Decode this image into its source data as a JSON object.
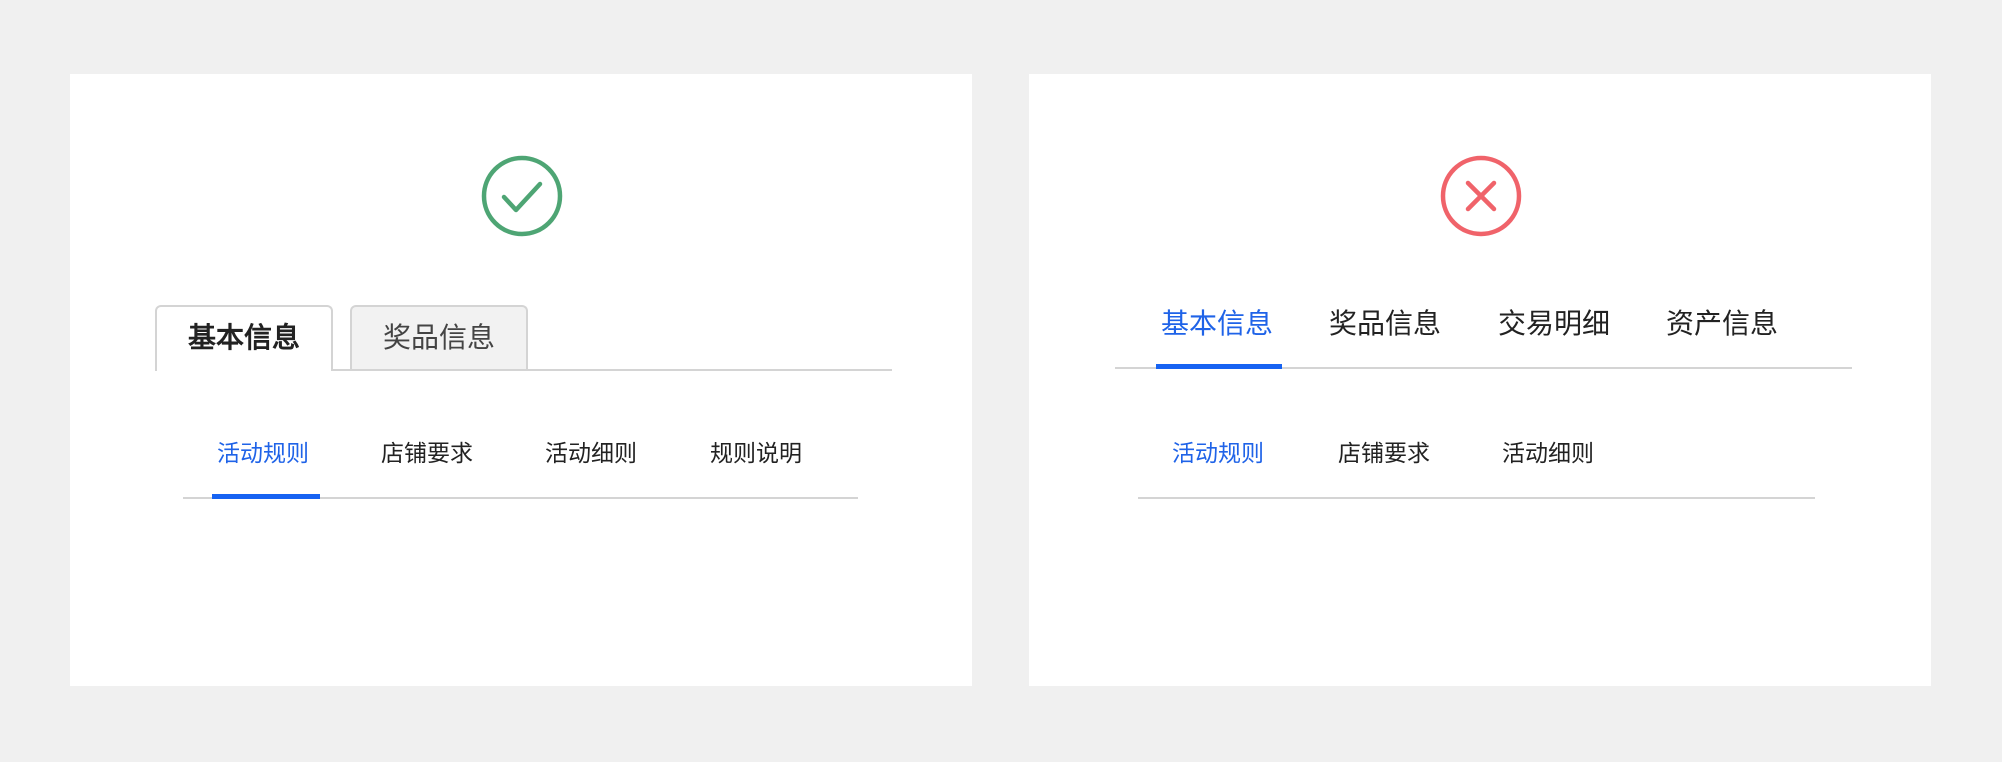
{
  "colors": {
    "accent": "#1763f2",
    "success": "#4ea574",
    "error": "#f0636a",
    "background": "#f0f0f0"
  },
  "left_example": {
    "icon": "check-circle-icon",
    "tabs": [
      {
        "label": "基本信息",
        "active": true
      },
      {
        "label": "奖品信息",
        "active": false
      }
    ],
    "subtabs": [
      {
        "label": "活动规则",
        "active": true
      },
      {
        "label": "店铺要求",
        "active": false
      },
      {
        "label": "活动细则",
        "active": false
      },
      {
        "label": "规则说明",
        "active": false
      }
    ]
  },
  "right_example": {
    "icon": "x-circle-icon",
    "tabs": [
      {
        "label": "基本信息",
        "active": true
      },
      {
        "label": "奖品信息",
        "active": false
      },
      {
        "label": "交易明细",
        "active": false
      },
      {
        "label": "资产信息",
        "active": false
      }
    ],
    "subtabs": [
      {
        "label": "活动规则",
        "active": true
      },
      {
        "label": "店铺要求",
        "active": false
      },
      {
        "label": "活动细则",
        "active": false
      }
    ]
  }
}
